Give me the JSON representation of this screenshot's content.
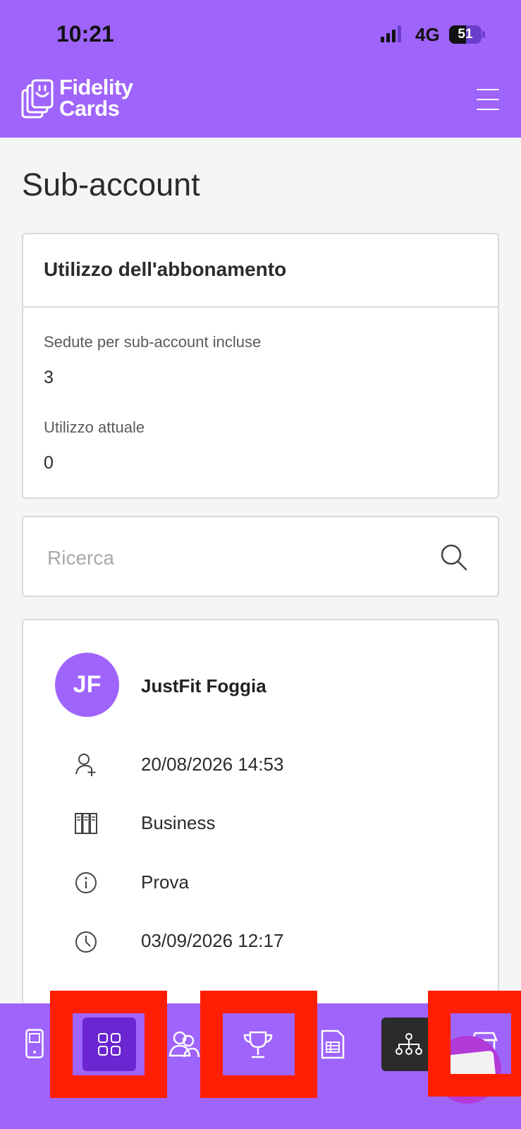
{
  "status_bar": {
    "time": "10:21",
    "network": "4G",
    "battery": "51"
  },
  "brand": {
    "line1": "Fidelity",
    "line2": "Cards"
  },
  "page": {
    "title": "Sub-account"
  },
  "usage_card": {
    "title": "Utilizzo dell'abbonamento",
    "seats_label": "Sedute per sub-account incluse",
    "seats_value": "3",
    "current_label": "Utilizzo attuale",
    "current_value": "0"
  },
  "search": {
    "placeholder": "Ricerca"
  },
  "account": {
    "initials": "JF",
    "name": "JustFit Foggia",
    "created": "20/08/2026 14:53",
    "plan": "Business",
    "status": "Prova",
    "expires": "03/09/2026 12:17"
  },
  "colors": {
    "brand": "#9f64fb",
    "brand_dark": "#6b26d1",
    "highlight_frame": "#ff1e00"
  },
  "bottom_nav": {
    "items": [
      {
        "icon": "phone-icon",
        "active": false
      },
      {
        "icon": "grid-icon",
        "active": true
      },
      {
        "icon": "users-icon",
        "active": false
      },
      {
        "icon": "trophy-icon",
        "active": false
      },
      {
        "icon": "sheet-icon",
        "active": false
      },
      {
        "icon": "hierarchy-icon",
        "active": false
      },
      {
        "icon": "store-icon",
        "active": false
      }
    ]
  }
}
